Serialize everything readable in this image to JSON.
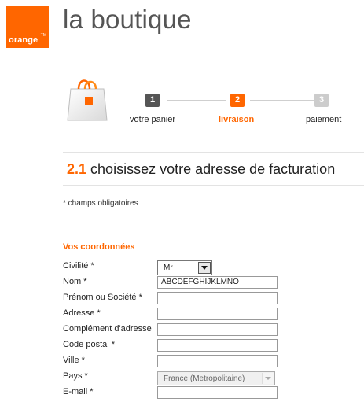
{
  "brand": {
    "logo_text": "orange",
    "logo_tm": "TM",
    "site_title": "la boutique",
    "accent": "#ff6600"
  },
  "checkout_steps": [
    {
      "number": "1",
      "label": "votre panier",
      "state": "done",
      "color": "#555555"
    },
    {
      "number": "2",
      "label": "livraison",
      "state": "active",
      "color": "#ff6600"
    },
    {
      "number": "3",
      "label": "paiement",
      "state": "upcoming",
      "color": "#cccccc"
    }
  ],
  "section": {
    "number": "2.1",
    "title": "choisissez votre adresse de facturation"
  },
  "required_note": "* champs obligatoires",
  "form": {
    "title": "Vos coordonnées",
    "fields": {
      "civilite": {
        "label": "Civilité *",
        "value": "Mr"
      },
      "nom": {
        "label": "Nom *",
        "value": "ABCDEFGHIJKLMNO"
      },
      "prenom": {
        "label": "Prénom ou Société *",
        "value": ""
      },
      "adresse": {
        "label": "Adresse *",
        "value": ""
      },
      "complement": {
        "label": "Complément d'adresse",
        "value": ""
      },
      "code_postal": {
        "label": "Code postal *",
        "value": ""
      },
      "ville": {
        "label": "Ville *",
        "value": ""
      },
      "pays": {
        "label": "Pays *",
        "value": "France (Metropolitaine)"
      },
      "email": {
        "label": "E-mail *",
        "value": ""
      }
    }
  },
  "icons": {
    "bag": "shopping-bag-icon",
    "dropdown": "chevron-down-icon"
  }
}
